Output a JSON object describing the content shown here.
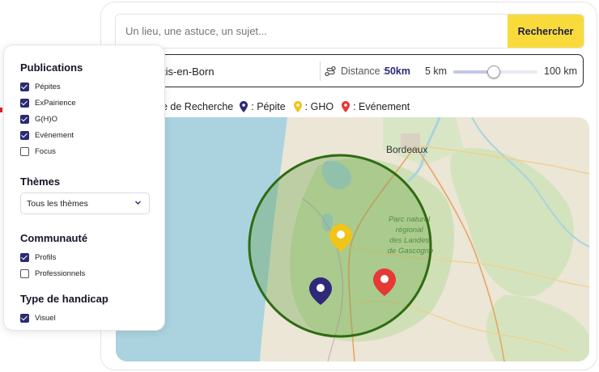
{
  "search": {
    "placeholder": "Un lieu, une astuce, un sujet...",
    "button_label": "Rechercher"
  },
  "location": {
    "text": "tis-en-Born",
    "distance_label": "Distance :",
    "distance_value": "50km",
    "slider_min": "5 km",
    "slider_max": "100 km",
    "slider_level": 0.48
  },
  "legend": {
    "zone_label": "e de Recherche",
    "items": [
      {
        "label": ": Pépite",
        "color": "#2e2a78"
      },
      {
        "label": ": GHO",
        "color": "#f0c419"
      },
      {
        "label": ": Evénement",
        "color": "#e53935"
      }
    ]
  },
  "map": {
    "city_label": "Bordeaux",
    "park_label_lines": [
      "Parc naturel",
      "régional",
      "des Landes",
      "de Gascogne"
    ],
    "radius_color": "#2f6b12",
    "markers": [
      {
        "type": "GHO",
        "color": "#f0c419"
      },
      {
        "type": "Pépite",
        "color": "#2e2a78"
      },
      {
        "type": "Evénement",
        "color": "#e53935"
      }
    ]
  },
  "filters": {
    "publications": {
      "title": "Publications",
      "items": [
        {
          "label": "Pépites",
          "checked": true
        },
        {
          "label": "ExPairience",
          "checked": true
        },
        {
          "label": "G(H)O",
          "checked": true
        },
        {
          "label": "Evénement",
          "checked": true
        },
        {
          "label": "Focus",
          "checked": false
        }
      ]
    },
    "themes": {
      "title": "Thèmes",
      "selected": "Tous les thèmes"
    },
    "community": {
      "title": "Communauté",
      "items": [
        {
          "label": "Profils",
          "checked": true
        },
        {
          "label": "Professionnels",
          "checked": false
        }
      ]
    },
    "handicap": {
      "title": "Type de handicap",
      "items": [
        {
          "label": "Visuel",
          "checked": true
        }
      ]
    }
  }
}
